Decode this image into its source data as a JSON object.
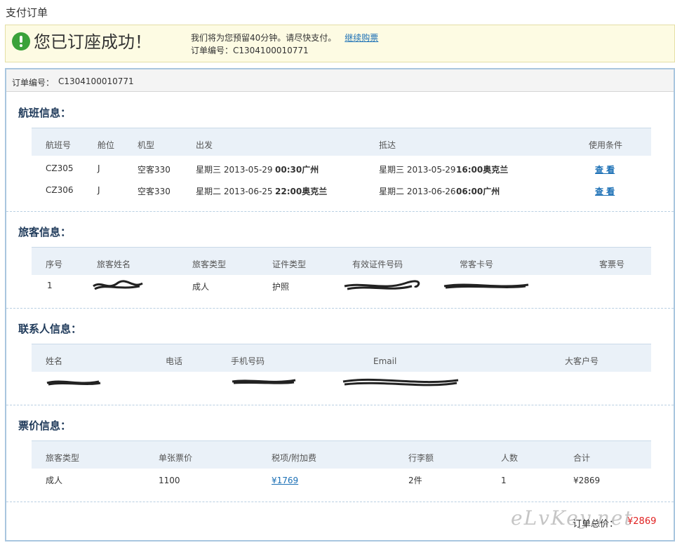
{
  "page": {
    "title": "支付订单"
  },
  "banner": {
    "title": "您已订座成功！",
    "hold_message": "我们将为您预留40分钟。请尽快支付。",
    "continue_link": "继续购票",
    "order_no_label": "订单编号：",
    "order_no": "C1304100010771"
  },
  "order": {
    "no_label": "订单编号：",
    "no": "C1304100010771"
  },
  "flight": {
    "title": "航班信息：",
    "headers": [
      "航班号",
      "舱位",
      "机型",
      "出发",
      "抵达",
      "使用条件"
    ],
    "rows": [
      {
        "flight_no": "CZ305",
        "cabin": "J",
        "aircraft": "空客330",
        "dep_date": "星期三 2013-05-29",
        "dep_time": "00:30广州",
        "arr_date": "星期三 2013-05-29",
        "arr_time": "16:00奥克兰",
        "rules": "查 看"
      },
      {
        "flight_no": "CZ306",
        "cabin": "J",
        "aircraft": "空客330",
        "dep_date": "星期二 2013-06-25",
        "dep_time": "22:00奥克兰",
        "arr_date": "星期二 2013-06-26",
        "arr_time": "06:00广州",
        "rules": "查 看"
      }
    ]
  },
  "passenger": {
    "title": "旅客信息：",
    "headers": [
      "序号",
      "旅客姓名",
      "旅客类型",
      "证件类型",
      "有效证件号码",
      "常客卡号",
      "客票号"
    ],
    "rows": [
      {
        "index": "1",
        "name": "",
        "type": "成人",
        "id_type": "护照",
        "id_no": "",
        "ff_no": "",
        "ticket_no": ""
      }
    ]
  },
  "contact": {
    "title": "联系人信息：",
    "headers": [
      "姓名",
      "电话",
      "手机号码",
      "Email",
      "大客户号"
    ]
  },
  "fare": {
    "title": "票价信息：",
    "headers": [
      "旅客类型",
      "单张票价",
      "税项/附加费",
      "行李额",
      "人数",
      "合计"
    ],
    "rows": [
      {
        "type": "成人",
        "price": "1100",
        "tax": "¥1769",
        "baggage": "2件",
        "count": "1",
        "total": "¥2869"
      }
    ]
  },
  "total": {
    "label": "订单总价：",
    "value": "¥2869"
  },
  "watermark": "eLvKey.net",
  "colors": {
    "accent": "#1a6fb5",
    "success": "#3aa23a",
    "price": "#e02020",
    "section_title": "#1f3a5a"
  }
}
